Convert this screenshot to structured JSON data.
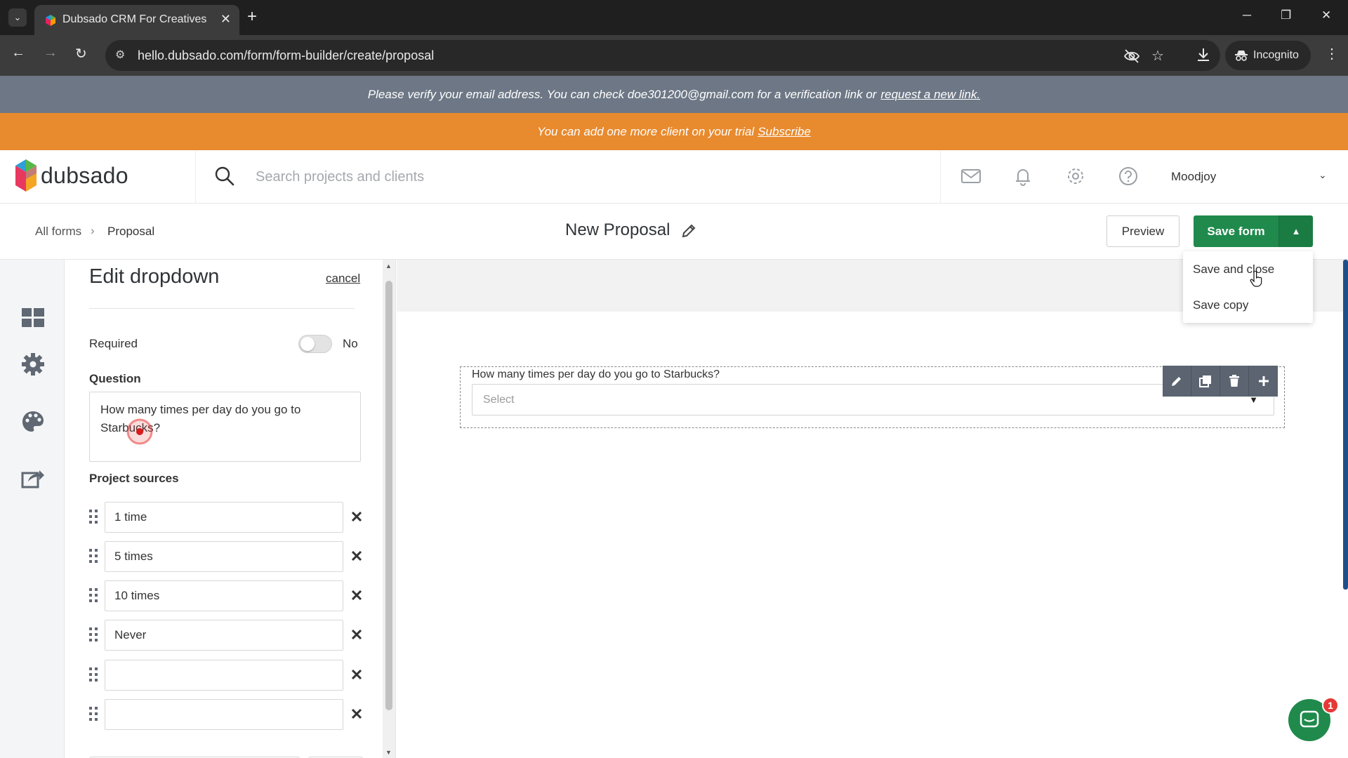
{
  "browser": {
    "tab_title": "Dubsado CRM For Creatives",
    "url": "hello.dubsado.com/form/form-builder/create/proposal",
    "incognito_label": "Incognito"
  },
  "banners": {
    "verify_text": "Please verify your email address. You can check doe301200@gmail.com for a verification link or",
    "verify_link": "request a new link.",
    "trial_text": "You can add one more client on your trial",
    "trial_link": "Subscribe"
  },
  "header": {
    "brand": "dubsado",
    "search_placeholder": "Search projects and clients",
    "user_name": "Moodjoy"
  },
  "subheader": {
    "breadcrumb_all": "All forms",
    "breadcrumb_current": "Proposal",
    "form_title": "New Proposal",
    "preview_label": "Preview",
    "save_label": "Save form"
  },
  "save_menu": {
    "items": [
      "Save and close",
      "Save copy"
    ]
  },
  "edit_panel": {
    "title": "Edit dropdown",
    "cancel_label": "cancel",
    "required_label": "Required",
    "required_value": "No",
    "question_label": "Question",
    "question_value": "How many times per day do you go to Starbucks?",
    "options_label": "Project sources",
    "options": [
      "1 time",
      "5 times",
      "10 times",
      "Never",
      "",
      ""
    ]
  },
  "canvas": {
    "field_question": "How many times per day do you go to Starbucks?",
    "select_placeholder": "Select"
  },
  "chat": {
    "badge_count": "1"
  },
  "colors": {
    "accent_green": "#1f8a4c",
    "trial_orange": "#e88a2e",
    "verify_gray": "#6d7785"
  }
}
